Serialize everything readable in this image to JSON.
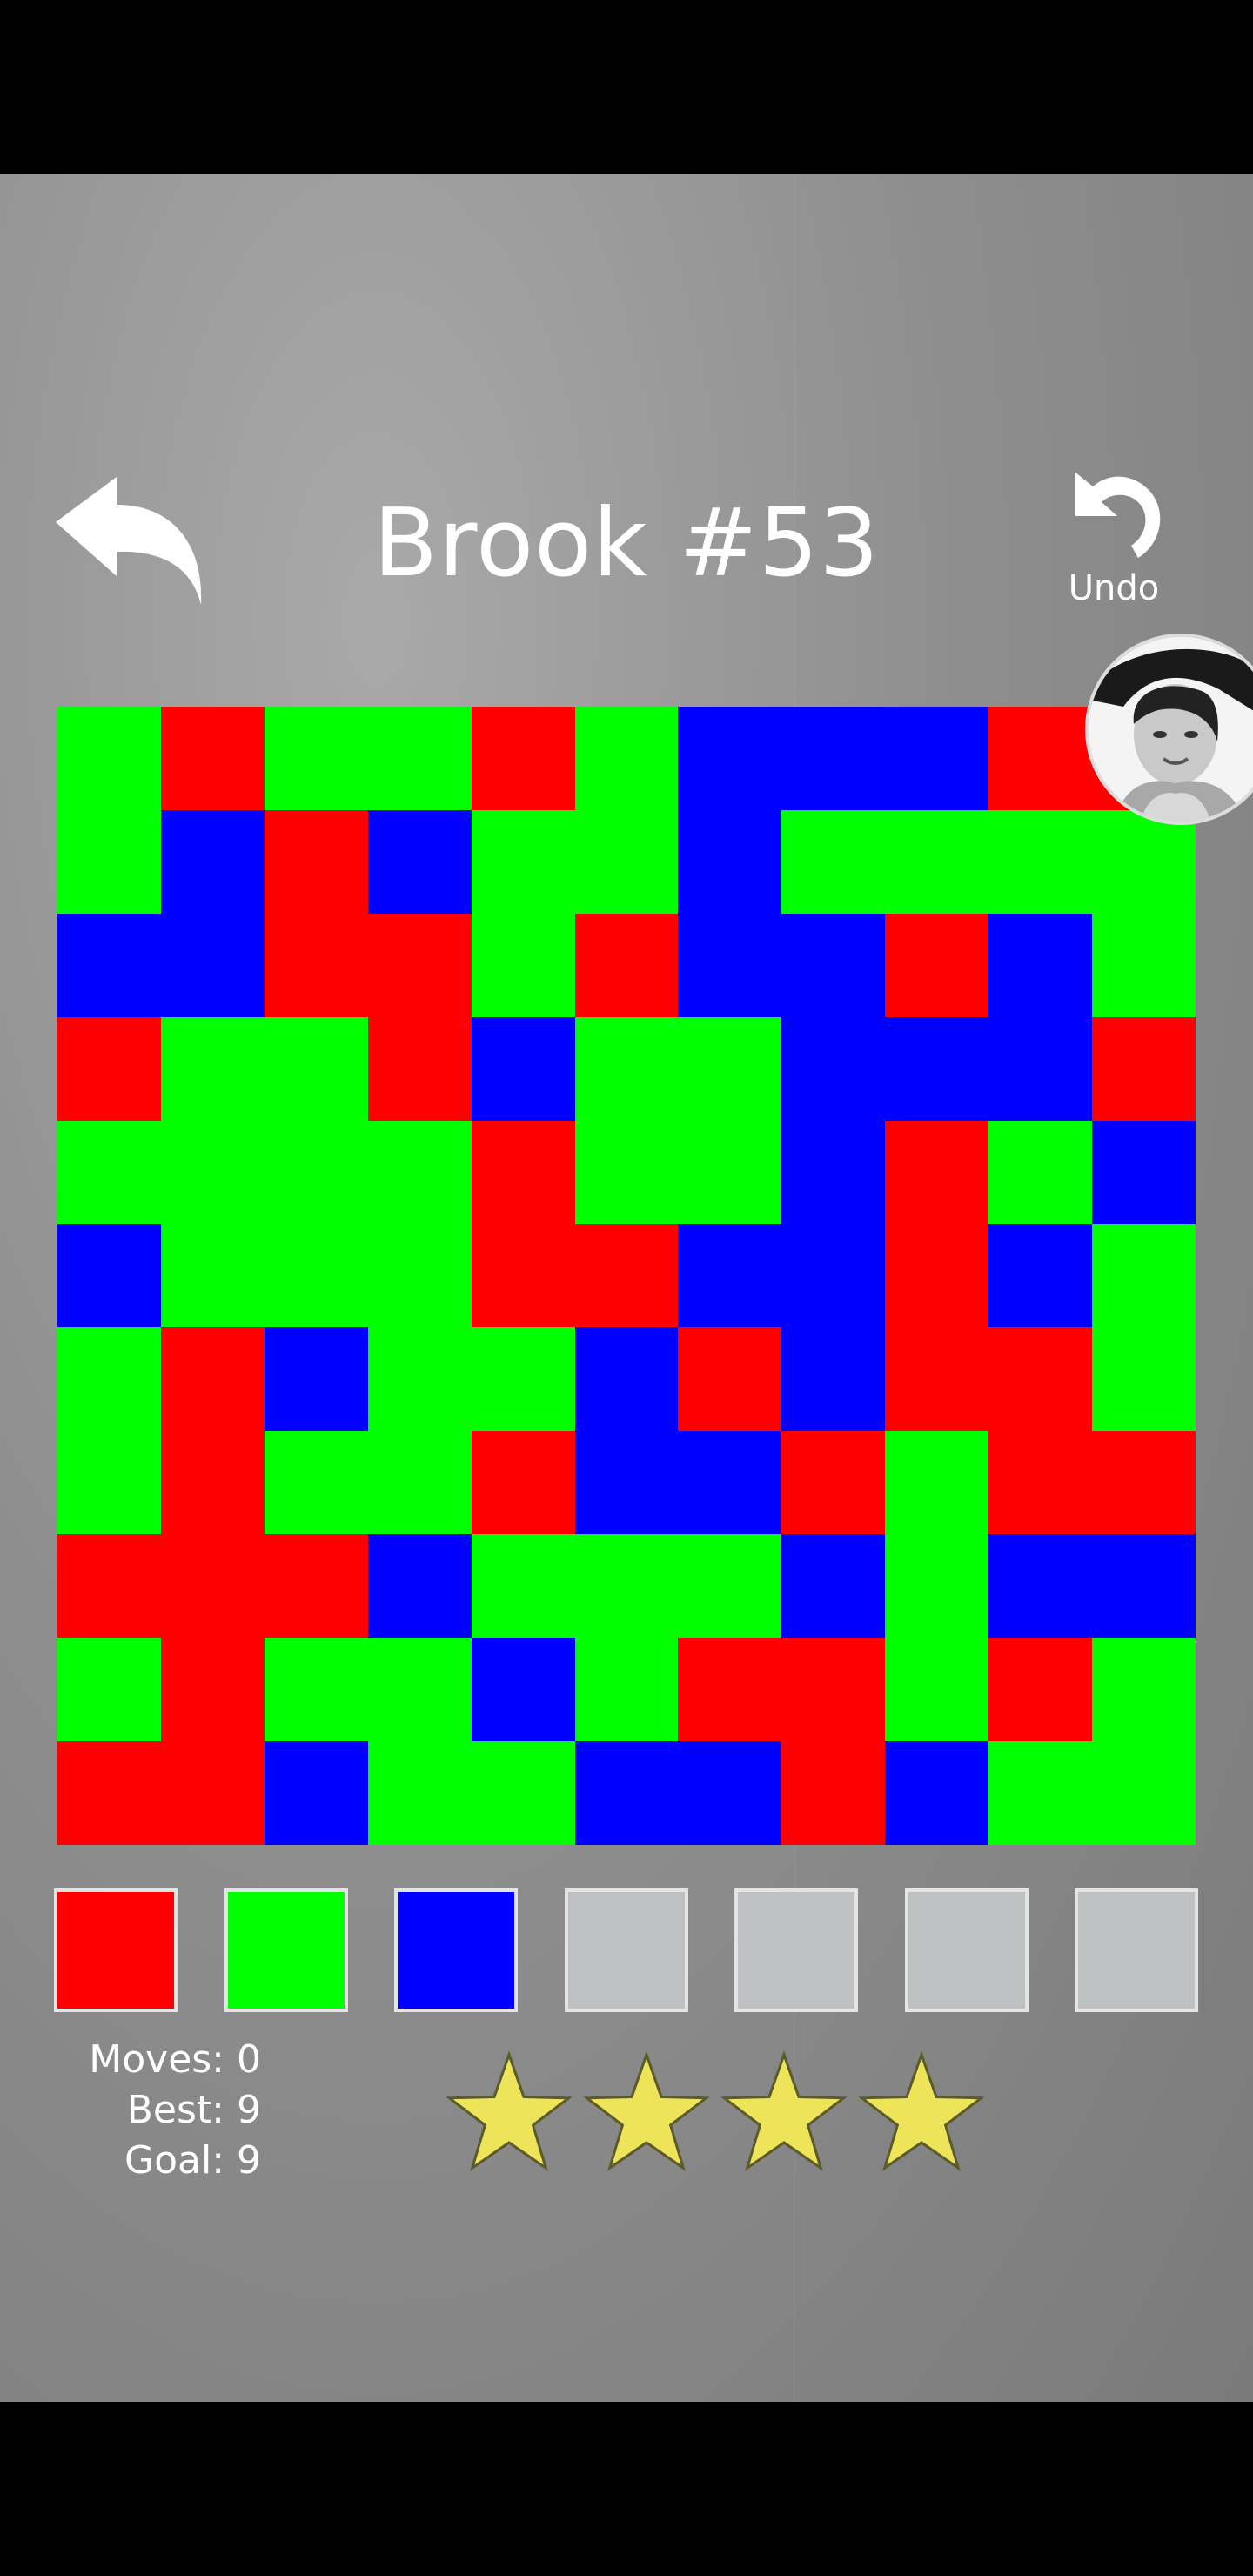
{
  "header": {
    "title": "Brook #53",
    "undo_label": "Undo"
  },
  "icons": {
    "back": "back-arrow-icon",
    "undo": "undo-arrow-icon",
    "avatar": "avatar-photo",
    "star": "star-icon"
  },
  "colors": {
    "R": "#ff0000",
    "G": "#00ff00",
    "B": "#0000ff",
    "empty_swatch": "#bdc1c2",
    "star_fill": "#ede45a",
    "star_stroke": "#5a5a2a"
  },
  "board": {
    "rows": [
      [
        "G",
        "R",
        "G",
        "G",
        "R",
        "G",
        "B",
        "B",
        "B",
        "R",
        "R"
      ],
      [
        "G",
        "B",
        "R",
        "B",
        "G",
        "G",
        "B",
        "G",
        "G",
        "G",
        "G"
      ],
      [
        "B",
        "B",
        "R",
        "R",
        "G",
        "R",
        "B",
        "B",
        "R",
        "B",
        "G"
      ],
      [
        "R",
        "G",
        "G",
        "R",
        "B",
        "G",
        "G",
        "B",
        "B",
        "B",
        "R"
      ],
      [
        "G",
        "G",
        "G",
        "G",
        "R",
        "G",
        "G",
        "B",
        "R",
        "G",
        "B"
      ],
      [
        "B",
        "G",
        "G",
        "G",
        "R",
        "R",
        "B",
        "B",
        "R",
        "B",
        "G"
      ],
      [
        "G",
        "R",
        "B",
        "G",
        "G",
        "B",
        "R",
        "B",
        "R",
        "R",
        "G"
      ],
      [
        "G",
        "R",
        "G",
        "G",
        "R",
        "B",
        "B",
        "R",
        "G",
        "R",
        "R"
      ],
      [
        "R",
        "R",
        "R",
        "B",
        "G",
        "G",
        "G",
        "B",
        "G",
        "B",
        "B"
      ],
      [
        "G",
        "R",
        "G",
        "G",
        "B",
        "G",
        "R",
        "R",
        "G",
        "R",
        "G"
      ],
      [
        "R",
        "R",
        "B",
        "G",
        "G",
        "B",
        "B",
        "R",
        "B",
        "G",
        "G"
      ]
    ]
  },
  "palette": [
    "R",
    "G",
    "B",
    "empty",
    "empty",
    "empty",
    "empty"
  ],
  "stats": {
    "moves": "Moves: 0",
    "best": "Best: 9",
    "goal": "Goal: 9"
  },
  "stars_count": 4
}
